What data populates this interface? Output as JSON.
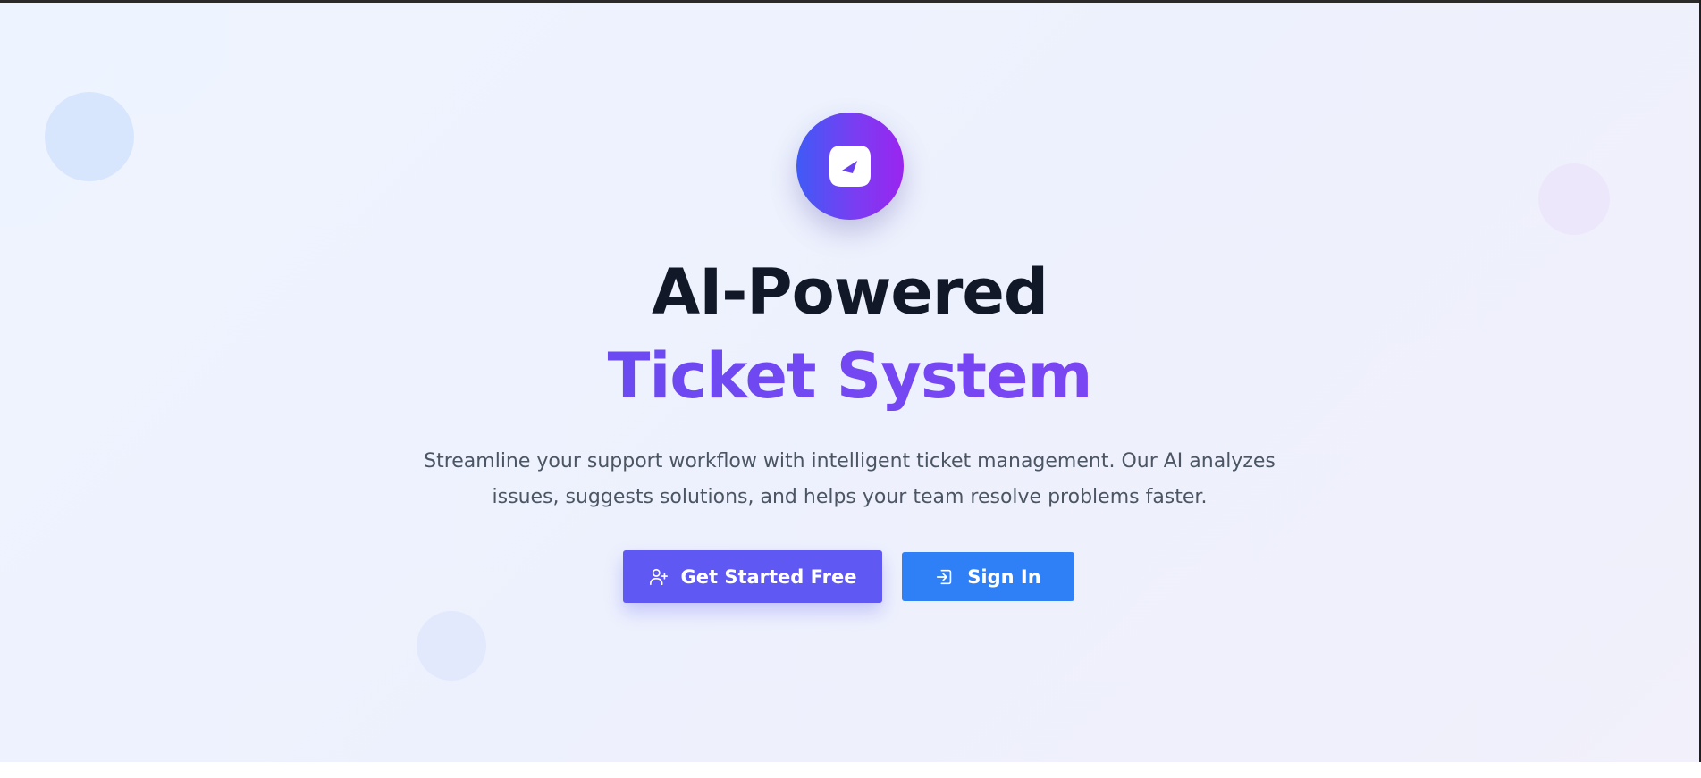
{
  "hero": {
    "logo_icon": "gauge-icon",
    "title_line_1": "AI-Powered",
    "title_line_2": "Ticket System",
    "description": "Streamline your support workflow with intelligent ticket management. Our AI analyzes issues, suggests solutions, and helps your team resolve problems faster.",
    "colors": {
      "accent_gradient_start": "#5a4ff0",
      "accent_gradient_end": "#8a3ff0",
      "primary_button": "#5f58f2",
      "secondary_button": "#2f80f7",
      "title_dark": "#111827",
      "body_text": "#4b5563"
    }
  },
  "actions": {
    "primary": {
      "label": "Get Started Free",
      "icon": "user-plus-icon"
    },
    "secondary": {
      "label": "Sign In",
      "icon": "sign-in-icon"
    }
  }
}
